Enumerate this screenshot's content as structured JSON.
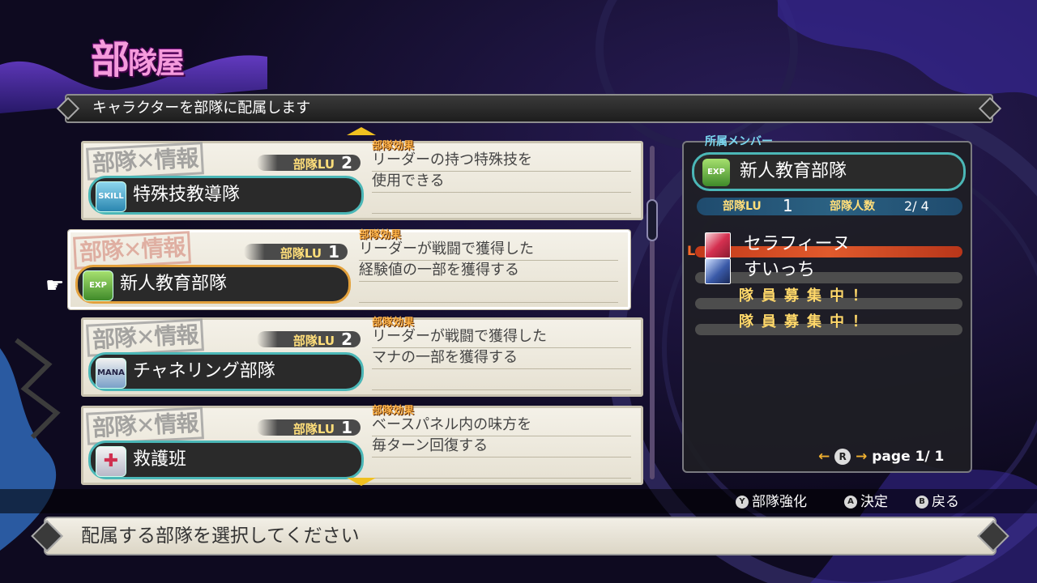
{
  "title": {
    "main": "部",
    "rest": "隊屋"
  },
  "header": {
    "text": "キャラクターを部隊に配属します"
  },
  "squads": [
    {
      "stamp": "部隊✕情報",
      "level_label": "部隊LU",
      "level": "2",
      "effect_label": "部隊効果",
      "effect_line1": "リーダーの持つ特殊技を",
      "effect_line2": "使用できる",
      "icon": "SKILL",
      "name": "特殊技教導隊",
      "selected": false
    },
    {
      "stamp": "部隊✕情報",
      "level_label": "部隊LU",
      "level": "1",
      "effect_label": "部隊効果",
      "effect_line1": "リーダーが戦闘で獲得した",
      "effect_line2": "経験値の一部を獲得する",
      "icon": "EXP",
      "name": "新人教育部隊",
      "selected": true
    },
    {
      "stamp": "部隊✕情報",
      "level_label": "部隊LU",
      "level": "2",
      "effect_label": "部隊効果",
      "effect_line1": "リーダーが戦闘で獲得した",
      "effect_line2": "マナの一部を獲得する",
      "icon": "MANA",
      "name": "チャネリング部隊",
      "selected": false
    },
    {
      "stamp": "部隊✕情報",
      "level_label": "部隊LU",
      "level": "1",
      "effect_label": "部隊効果",
      "effect_line1": "ベースパネル内の味方を",
      "effect_line2": "毎ターン回復する",
      "icon": "✚",
      "name": "救護班",
      "selected": false
    }
  ],
  "member_panel": {
    "title": "所属メンバー",
    "squad_icon": "EXP",
    "squad_name": "新人教育部隊",
    "level_label": "部隊LU",
    "level": "1",
    "count_label": "部隊人数",
    "count": "2/ 4",
    "leader_mark": "L",
    "members": [
      {
        "name": "セラフィーヌ"
      },
      {
        "name": "すいっち"
      }
    ],
    "recruit_text": "隊員募集中！",
    "pager": {
      "label": "page",
      "value": "1/ 1",
      "button": "R"
    }
  },
  "hints": [
    {
      "button": "Y",
      "label": "部隊強化"
    },
    {
      "button": "A",
      "label": "決定"
    },
    {
      "button": "B",
      "label": "戻る"
    }
  ],
  "message": "配属する部隊を選択してください",
  "colors": {
    "accent_teal": "#4bb7b7",
    "selected_orange": "#e3a13c",
    "title_pink": "#f59bdc",
    "label_yellow": "#ffde7a"
  }
}
